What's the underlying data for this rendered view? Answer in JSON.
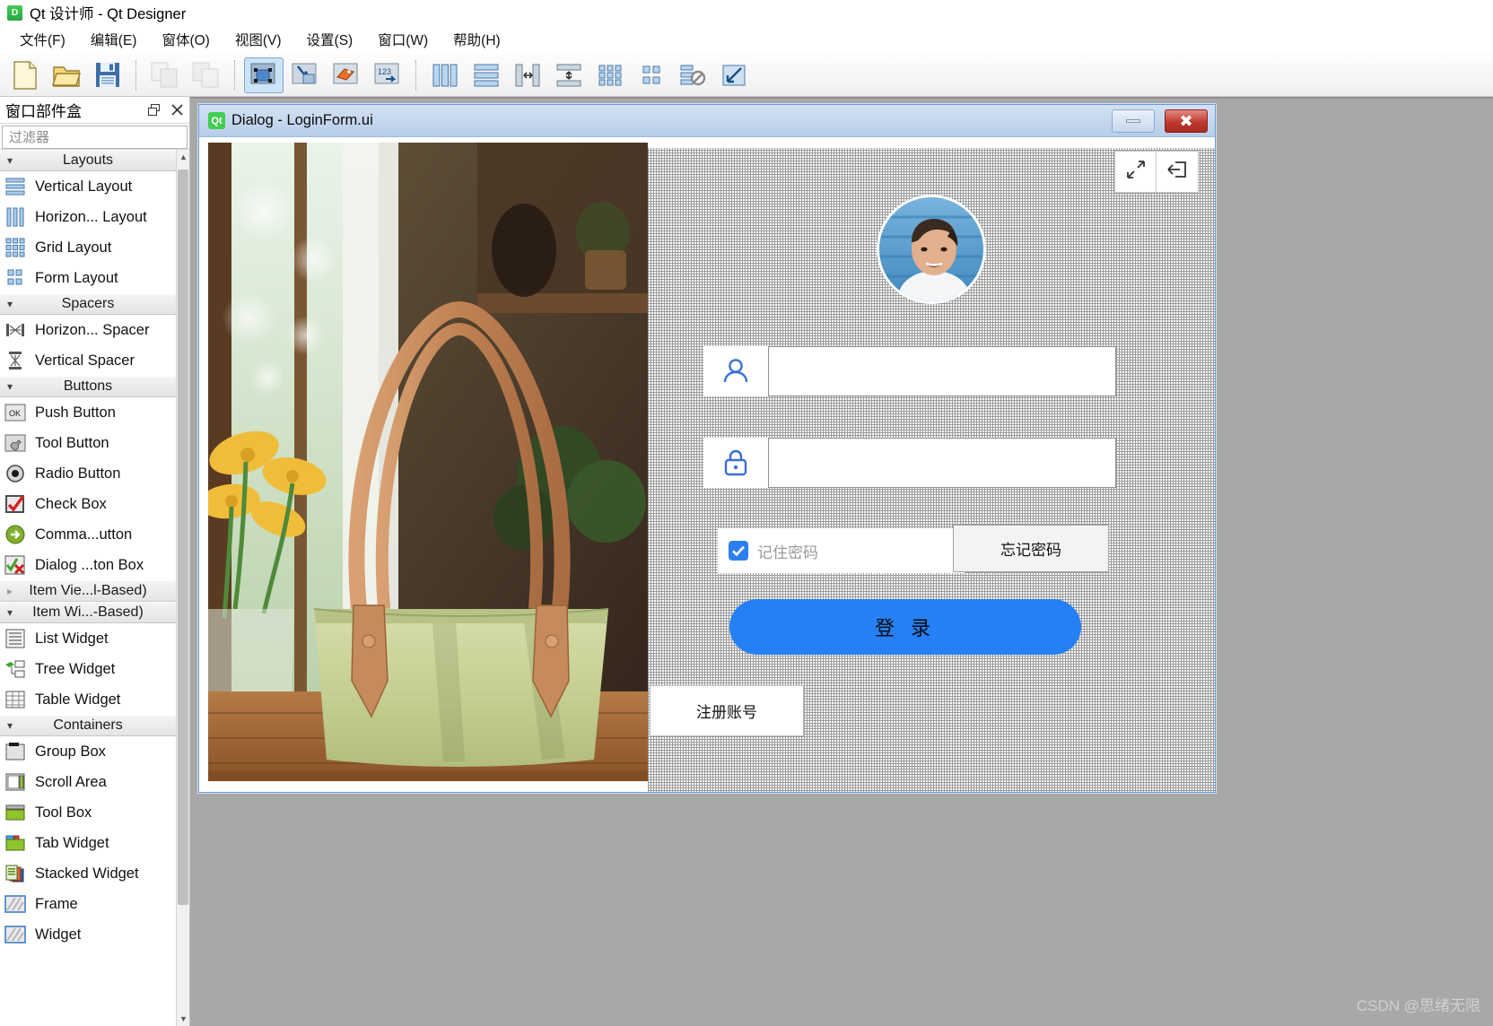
{
  "app": {
    "title": "Qt 设计师 - Qt Designer",
    "logo_text": "D"
  },
  "menubar": {
    "items": [
      {
        "label": "文件(F)"
      },
      {
        "label": "编辑(E)"
      },
      {
        "label": "窗体(O)"
      },
      {
        "label": "视图(V)"
      },
      {
        "label": "设置(S)"
      },
      {
        "label": "窗口(W)"
      },
      {
        "label": "帮助(H)"
      }
    ]
  },
  "toolbar": {
    "groups": [
      {
        "buttons": [
          {
            "icon": "new-file-icon",
            "state": "normal"
          },
          {
            "icon": "open-folder-icon",
            "state": "normal"
          },
          {
            "icon": "save-icon",
            "state": "normal"
          }
        ]
      },
      {
        "buttons": [
          {
            "icon": "undo-icon",
            "state": "disabled"
          },
          {
            "icon": "redo-icon",
            "state": "disabled"
          }
        ]
      },
      {
        "buttons": [
          {
            "icon": "edit-widgets-icon",
            "state": "active"
          },
          {
            "icon": "edit-signals-slots-icon",
            "state": "normal"
          },
          {
            "icon": "edit-buddies-icon",
            "state": "normal"
          },
          {
            "icon": "edit-tab-order-icon",
            "state": "normal"
          }
        ]
      },
      {
        "buttons": [
          {
            "icon": "layout-horizontal-icon",
            "state": "normal"
          },
          {
            "icon": "layout-vertical-icon",
            "state": "normal"
          },
          {
            "icon": "layout-splitter-horizontal-icon",
            "state": "normal"
          },
          {
            "icon": "layout-splitter-vertical-icon",
            "state": "normal"
          },
          {
            "icon": "layout-grid-icon",
            "state": "normal"
          },
          {
            "icon": "layout-form-icon",
            "state": "normal"
          },
          {
            "icon": "break-layout-icon",
            "state": "normal"
          },
          {
            "icon": "adjust-size-icon",
            "state": "normal"
          }
        ]
      }
    ]
  },
  "widget_box": {
    "title": "窗口部件盒",
    "float_button": "restore-icon",
    "close_button": "close-icon",
    "filter": {
      "value": "",
      "placeholder": "过滤器"
    },
    "categories": [
      {
        "label": "Layouts",
        "expanded": true,
        "items": [
          {
            "label": "Vertical Layout",
            "icon": "vertical-layout-icon"
          },
          {
            "label": "Horizon... Layout",
            "icon": "horizontal-layout-icon"
          },
          {
            "label": "Grid Layout",
            "icon": "grid-layout-icon"
          },
          {
            "label": "Form Layout",
            "icon": "form-layout-icon"
          }
        ]
      },
      {
        "label": "Spacers",
        "expanded": true,
        "items": [
          {
            "label": "Horizon... Spacer",
            "icon": "horizontal-spacer-icon"
          },
          {
            "label": "Vertical Spacer",
            "icon": "vertical-spacer-icon"
          }
        ]
      },
      {
        "label": "Buttons",
        "expanded": true,
        "items": [
          {
            "label": "Push Button",
            "icon": "push-button-icon"
          },
          {
            "label": "Tool Button",
            "icon": "tool-button-icon"
          },
          {
            "label": "Radio Button",
            "icon": "radio-button-icon"
          },
          {
            "label": "Check Box",
            "icon": "check-box-icon"
          },
          {
            "label": "Comma...utton",
            "icon": "command-link-button-icon"
          },
          {
            "label": "Dialog ...ton Box",
            "icon": "dialog-button-box-icon"
          }
        ]
      },
      {
        "label": "Item Vie...l-Based)",
        "expanded": false,
        "items": []
      },
      {
        "label": "Item Wi...-Based)",
        "expanded": true,
        "items": [
          {
            "label": "List Widget",
            "icon": "list-widget-icon"
          },
          {
            "label": "Tree Widget",
            "icon": "tree-widget-icon"
          },
          {
            "label": "Table Widget",
            "icon": "table-widget-icon"
          }
        ]
      },
      {
        "label": "Containers",
        "expanded": true,
        "items": [
          {
            "label": "Group Box",
            "icon": "group-box-icon"
          },
          {
            "label": "Scroll Area",
            "icon": "scroll-area-icon"
          },
          {
            "label": "Tool Box",
            "icon": "tool-box-icon"
          },
          {
            "label": "Tab Widget",
            "icon": "tab-widget-icon"
          },
          {
            "label": "Stacked Widget",
            "icon": "stacked-widget-icon"
          },
          {
            "label": "Frame",
            "icon": "frame-icon"
          },
          {
            "label": "Widget",
            "icon": "widget-icon"
          }
        ]
      }
    ]
  },
  "dialog": {
    "title": "Dialog - LoginForm.ui",
    "logo_text": "Qt",
    "minimize_label": "minimize-icon",
    "close_label": "close-icon",
    "photo_alt": "green tote bag on wooden table with yellow flowers",
    "top_buttons": [
      {
        "icon": "collapse-arrows-icon"
      },
      {
        "icon": "exit-arrow-icon"
      }
    ],
    "avatar": {
      "icon": "user-avatar-photo"
    },
    "username_field": {
      "value": "",
      "placeholder": "",
      "icon": "user-icon"
    },
    "password_field": {
      "value": "",
      "placeholder": "",
      "icon": "lock-icon"
    },
    "remember": {
      "label": "记住密码",
      "checked": true
    },
    "forgot_button": "忘记密码",
    "login_button": "登 录",
    "register_button": "注册账号"
  },
  "watermark": "CSDN @思绪无限",
  "colors": {
    "accent_blue": "#2680f5",
    "checkbox_blue": "#2d7ff0",
    "title_bar_blue": "#b7cde8",
    "close_red": "#bd3a30",
    "qt_green": "#41cd52",
    "workspace_gray": "#a8a8a8"
  }
}
